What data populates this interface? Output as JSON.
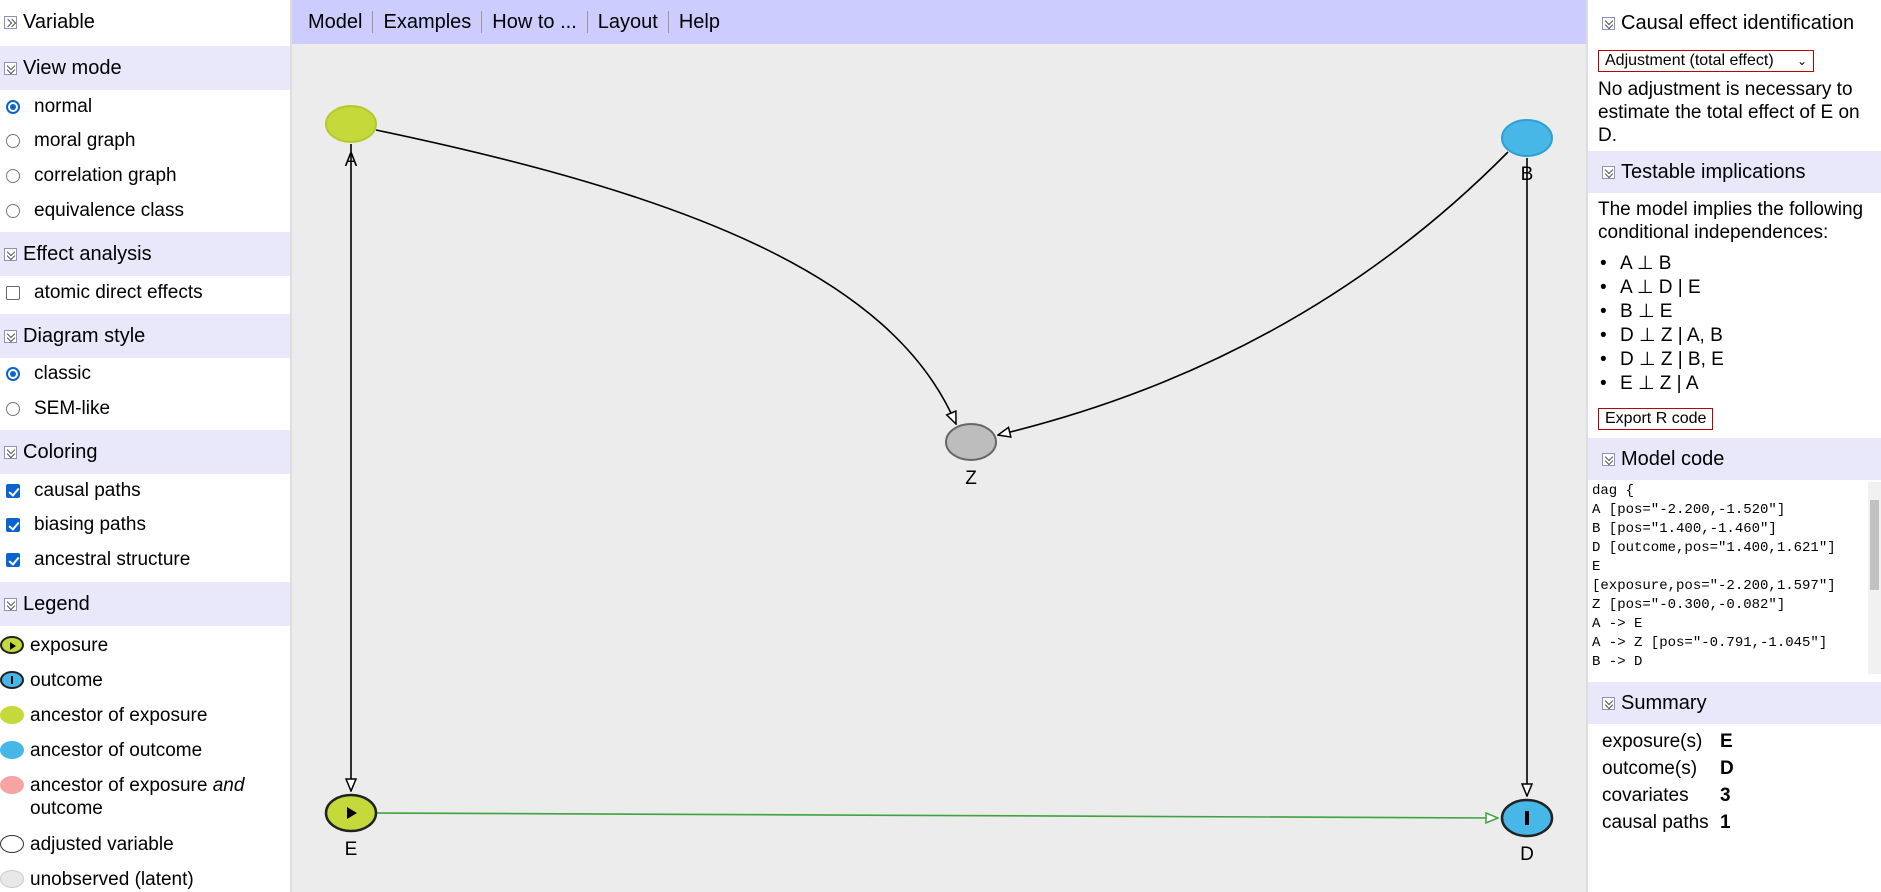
{
  "left": {
    "variable_title": "Variable",
    "view_mode": {
      "title": "View mode",
      "options": [
        "normal",
        "moral graph",
        "correlation graph",
        "equivalence class"
      ],
      "selected": "normal"
    },
    "effect_analysis": {
      "title": "Effect analysis",
      "options": [
        {
          "label": "atomic direct effects",
          "checked": false
        }
      ]
    },
    "diagram_style": {
      "title": "Diagram style",
      "options": [
        "classic",
        "SEM-like"
      ],
      "selected": "classic"
    },
    "coloring": {
      "title": "Coloring",
      "options": [
        {
          "label": "causal paths",
          "checked": true
        },
        {
          "label": "biasing paths",
          "checked": true
        },
        {
          "label": "ancestral structure",
          "checked": true
        }
      ]
    },
    "legend": {
      "title": "Legend",
      "items": [
        {
          "label": "exposure",
          "label_em": "",
          "label_after": "",
          "color": "#c6d93a",
          "icon": "play-icon"
        },
        {
          "label": "outcome",
          "label_em": "",
          "label_after": "",
          "color": "#47b7e8",
          "icon": "bar-icon"
        },
        {
          "label": "ancestor of exposure",
          "label_em": "",
          "label_after": "",
          "color": "#c6d93a",
          "icon": ""
        },
        {
          "label": "ancestor of outcome",
          "label_em": "",
          "label_after": "",
          "color": "#47b7e8",
          "icon": ""
        },
        {
          "label": "ancestor of exposure ",
          "label_em": "and",
          "label_after": " outcome",
          "color": "#f5a3a3",
          "icon": ""
        },
        {
          "label": "adjusted variable",
          "label_em": "",
          "label_after": "",
          "color": "#ffffff",
          "icon": ""
        },
        {
          "label": "unobserved (latent)",
          "label_em": "",
          "label_after": "",
          "color": "#e8e8e8",
          "icon": ""
        }
      ]
    }
  },
  "menu": [
    "Model",
    "Examples",
    "How to ...",
    "Layout",
    "Help"
  ],
  "graph": {
    "nodes": [
      {
        "id": "A",
        "label": "A",
        "role": "ancestor of exposure",
        "color": "#c6d93a"
      },
      {
        "id": "B",
        "label": "B",
        "role": "ancestor of outcome",
        "color": "#47b7e8"
      },
      {
        "id": "Z",
        "label": "Z",
        "role": "other",
        "color": "#bdbdbd"
      },
      {
        "id": "E",
        "label": "E",
        "role": "exposure",
        "color": "#c6d93a"
      },
      {
        "id": "D",
        "label": "D",
        "role": "outcome",
        "color": "#47b7e8"
      }
    ],
    "edges": [
      {
        "from": "A",
        "to": "E",
        "type": "plain",
        "color": "#000000"
      },
      {
        "from": "A",
        "to": "Z",
        "type": "curved",
        "color": "#000000"
      },
      {
        "from": "B",
        "to": "Z",
        "type": "curved",
        "color": "#000000"
      },
      {
        "from": "B",
        "to": "D",
        "type": "plain",
        "color": "#000000"
      },
      {
        "from": "E",
        "to": "D",
        "type": "causal",
        "color": "#3fa33f"
      }
    ]
  },
  "right": {
    "causal": {
      "title": "Causal effect identification",
      "select_value": "Adjustment (total effect)",
      "message": "No adjustment is necessary to estimate the total effect of E on D."
    },
    "testable": {
      "title": "Testable implications",
      "intro": "The model implies the following conditional independences:",
      "items": [
        "A ⊥ B",
        "A ⊥ D | E",
        "B ⊥ E",
        "D ⊥ Z | A, B",
        "D ⊥ Z | B, E",
        "E ⊥ Z | A"
      ],
      "export_label": "Export R code"
    },
    "model_code": {
      "title": "Model code",
      "lines": [
        "dag {",
        "A [pos=\"-2.200,-1.520\"]",
        "B [pos=\"1.400,-1.460\"]",
        "D [outcome,pos=\"1.400,1.621\"]",
        "E",
        "[exposure,pos=\"-2.200,1.597\"]",
        "Z [pos=\"-0.300,-0.082\"]",
        "A -> E",
        "A -> Z [pos=\"-0.791,-1.045\"]",
        "B -> D"
      ]
    },
    "summary": {
      "title": "Summary",
      "rows": [
        {
          "key": "exposure(s)",
          "value": "E"
        },
        {
          "key": "outcome(s)",
          "value": "D"
        },
        {
          "key": "covariates",
          "value": "3"
        },
        {
          "key": "causal paths",
          "value": "1"
        }
      ]
    }
  }
}
